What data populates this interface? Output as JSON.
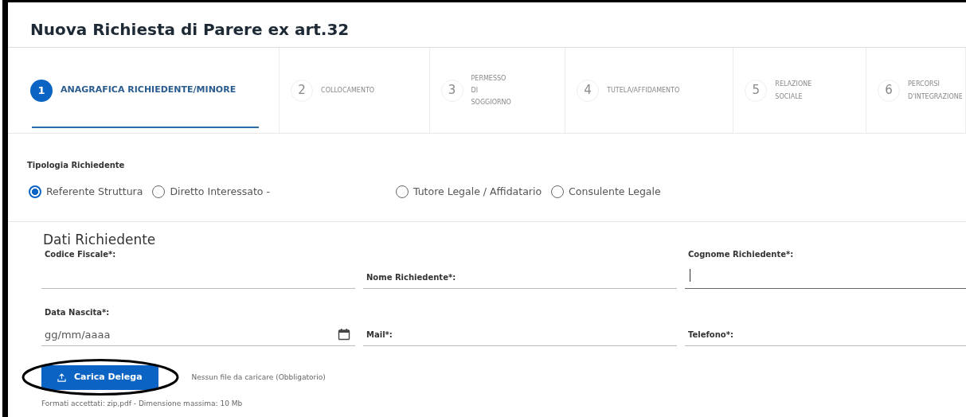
{
  "title": "Nuova Richiesta di Parere ex art.32",
  "steps": [
    {
      "number": "1",
      "label": "ANAGRAFICA RICHIEDENTE/MINORE",
      "selected": true
    },
    {
      "number": "2",
      "label": "COLLOCAMENTO",
      "selected": false
    },
    {
      "number": "3",
      "label": "PERMESSO DI SOGGIORNO",
      "selected": false
    },
    {
      "number": "4",
      "label": "TUTELA/AFFIDAMENTO",
      "selected": false
    },
    {
      "number": "5",
      "label": "RELAZIONE SOCIALE",
      "selected": false
    },
    {
      "number": "6",
      "label": "PERCORSI D'INTEGRAZIONE",
      "selected": false
    }
  ],
  "requester_type": {
    "label": "Tipologia Richiedente",
    "options": [
      {
        "label": "Referente Struttura",
        "selected": true
      },
      {
        "label": "Diretto Interessato -",
        "selected": false
      },
      {
        "label": "Tutore Legale / Affidatario",
        "selected": false
      },
      {
        "label": "Consulente Legale",
        "selected": false
      }
    ]
  },
  "section_title": "Dati Richiedente",
  "fields": [
    {
      "label": "Codice Fiscale*:",
      "raised": true,
      "focused": false,
      "kind": "text"
    },
    {
      "label": "Nome Richiedente*:",
      "raised": false,
      "focused": false,
      "kind": "text"
    },
    {
      "label": "Cognome Richiedente*:",
      "raised": true,
      "focused": true,
      "kind": "text"
    },
    {
      "label": "Data Nascita*:",
      "raised": true,
      "focused": false,
      "kind": "date",
      "placeholder": "gg/mm/aaaa"
    },
    {
      "label": "Mail*:",
      "raised": false,
      "focused": false,
      "kind": "text"
    },
    {
      "label": "Telefono*:",
      "raised": false,
      "focused": false,
      "kind": "text"
    }
  ],
  "upload": {
    "button": "Carica Delega",
    "status": "Nessun file da caricare (Obbligatorio)",
    "formats": "Formati accettati: zip,pdf - Dimensione massima: 10 Mb"
  },
  "annotations": [
    {
      "kind": "ellipse"
    }
  ]
}
